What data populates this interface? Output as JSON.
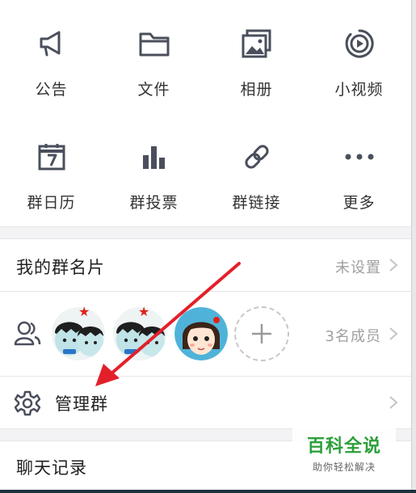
{
  "tools": [
    {
      "label": "公告",
      "icon": "megaphone-icon"
    },
    {
      "label": "文件",
      "icon": "folder-icon"
    },
    {
      "label": "相册",
      "icon": "photo-album-icon"
    },
    {
      "label": "小视频",
      "icon": "video-icon"
    },
    {
      "label": "群日历",
      "icon": "calendar-icon"
    },
    {
      "label": "群投票",
      "icon": "bar-chart-icon"
    },
    {
      "label": "群链接",
      "icon": "link-icon"
    },
    {
      "label": "更多",
      "icon": "more-dots-icon"
    }
  ],
  "group_nickname": {
    "title": "我的群名片",
    "value": "未设置"
  },
  "members": {
    "count_text": "3名成员",
    "icon": "members-icon"
  },
  "manage": {
    "title": "管理群",
    "icon": "gear-icon"
  },
  "chat_history": {
    "title": "聊天记录"
  },
  "watermark": {
    "title": "百科全说",
    "subtitle": "助你轻松解决"
  },
  "colors": {
    "icon": "#4a4f5c",
    "annotation_arrow": "#e3202a",
    "watermark_green": "#2c9f3a",
    "separator": "#f3f3f5"
  }
}
